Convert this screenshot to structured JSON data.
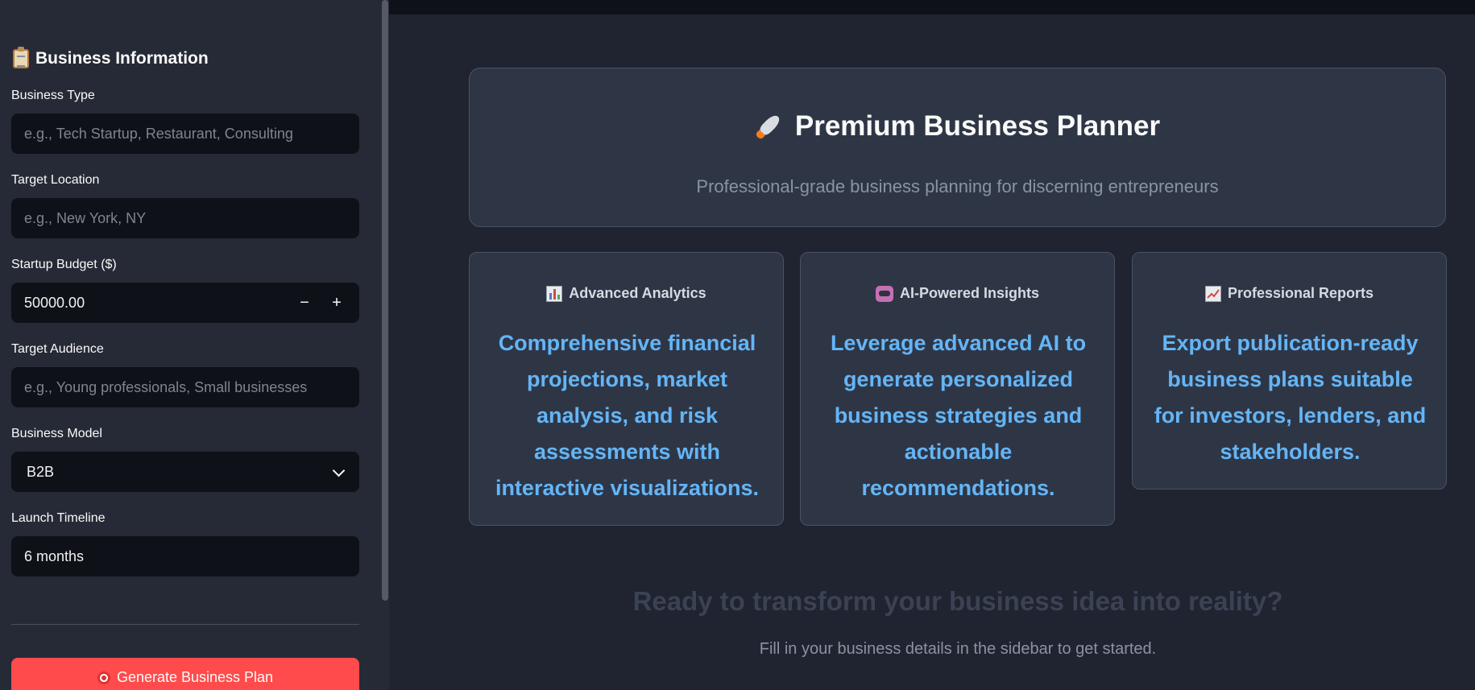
{
  "sidebar": {
    "section_title": "Business Information",
    "fields": {
      "business_type": {
        "label": "Business Type",
        "placeholder": "e.g., Tech Startup, Restaurant, Consulting",
        "value": ""
      },
      "target_location": {
        "label": "Target Location",
        "placeholder": "e.g., New York, NY",
        "value": ""
      },
      "startup_budget": {
        "label": "Startup Budget ($)",
        "value": "50000.00",
        "decrement": "−",
        "increment": "+"
      },
      "target_audience": {
        "label": "Target Audience",
        "placeholder": "e.g., Young professionals, Small businesses",
        "value": ""
      },
      "business_model": {
        "label": "Business Model",
        "selected": "B2B"
      },
      "launch_timeline": {
        "label": "Launch Timeline",
        "value": "6 months"
      }
    },
    "generate_button": "Generate Business Plan"
  },
  "hero": {
    "title": "Premium Business Planner",
    "subtitle": "Professional-grade business planning for discerning entrepreneurs"
  },
  "features": [
    {
      "title": "Advanced Analytics",
      "description": "Comprehensive financial projections, market analysis, and risk assessments with interactive visualizations."
    },
    {
      "title": "AI-Powered Insights",
      "description": "Leverage advanced AI to generate personalized business strategies and actionable recommendations."
    },
    {
      "title": "Professional Reports",
      "description": "Export publication-ready business plans suitable for investors, lenders, and stakeholders."
    }
  ],
  "cta": {
    "title": "Ready to transform your business idea into reality?",
    "subtitle": "Fill in your business details in the sidebar to get started."
  },
  "colors": {
    "accent": "#ff4b4b",
    "feature_text": "#64b5f6",
    "background": "#1f2430",
    "sidebar": "#262a36"
  }
}
